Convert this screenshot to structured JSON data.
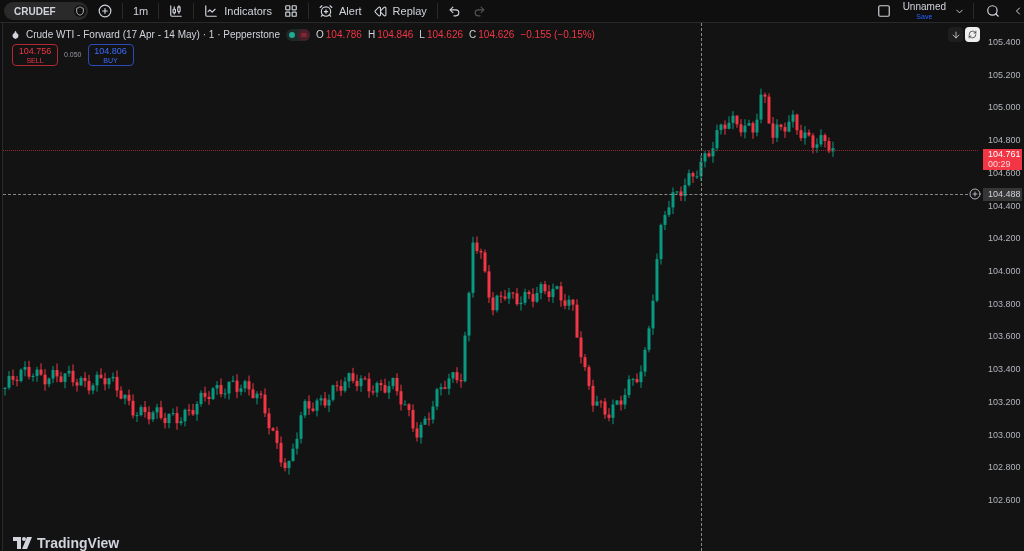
{
  "toolbar": {
    "symbol": "CRUDEF",
    "interval": "1m",
    "indicators": "Indicators",
    "alert": "Alert",
    "replay": "Replay",
    "layout": {
      "name": "Unnamed",
      "action": "Save"
    }
  },
  "legend": {
    "title": "Crude WTI - Forward (17 Apr - 14 May) · 1 · Pepperstone",
    "ohlc": [
      {
        "label": "O",
        "value": "104.786"
      },
      {
        "label": "H",
        "value": "104.846"
      },
      {
        "label": "L",
        "value": "104.626"
      },
      {
        "label": "C",
        "value": "104.626"
      }
    ],
    "change": "−0.155 (−0.15%)",
    "sell": {
      "price": "104.756",
      "label": "SELL"
    },
    "spread": "0.050",
    "buy": {
      "price": "104.806",
      "label": "BUY"
    }
  },
  "price_axis": {
    "labels": [
      "105.400",
      "105.200",
      "105.000",
      "104.800",
      "104.600",
      "104.400",
      "104.200",
      "104.000",
      "103.800",
      "103.600",
      "103.400",
      "103.200",
      "103.000",
      "102.800",
      "102.600"
    ],
    "last_price": {
      "price": "104.761",
      "countdown": "00:29"
    },
    "crosshair_price": "104.488"
  },
  "branding": "TradingView"
}
